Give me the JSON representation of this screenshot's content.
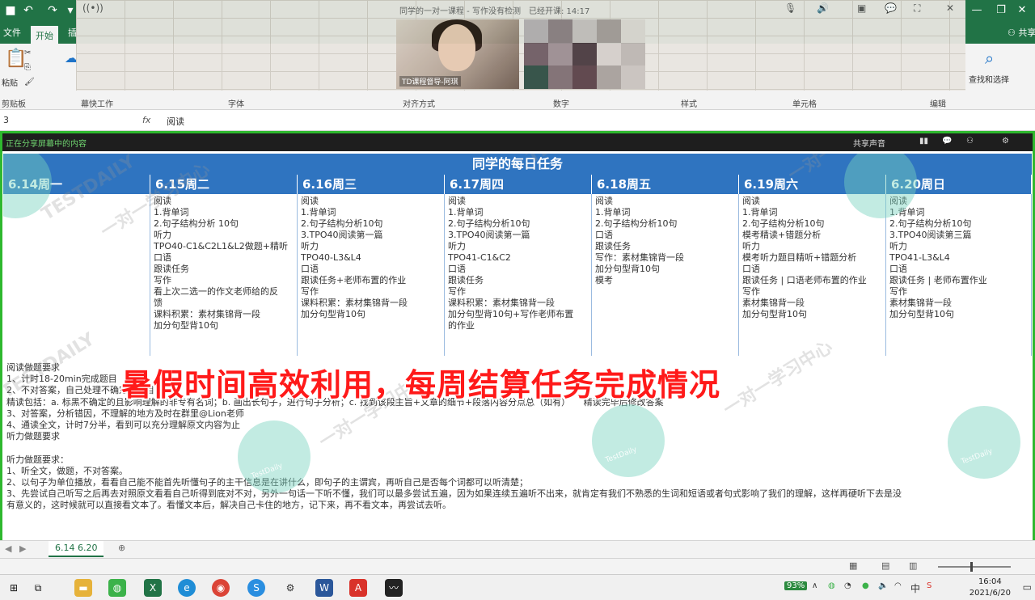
{
  "window": {
    "meeting_title": "同学的一对一课程 - 写作没有检测　已经开课: 14:17"
  },
  "ribbon": {
    "tabs": [
      "文件",
      "开始",
      "插"
    ],
    "active_tab": "开始",
    "buttons": {
      "paste": "粘贴",
      "find": "查找和选择"
    },
    "groups": [
      "剪贴板",
      "幕快工作",
      "字体",
      "对齐方式",
      "数字",
      "样式",
      "单元格",
      "编辑"
    ]
  },
  "formula_bar": {
    "name_box": "3",
    "content": "阅读"
  },
  "share": {
    "label": "正在分享屏幕中的内容",
    "right": [
      "共享声音"
    ]
  },
  "sheet": {
    "title": "同学的每日任务",
    "days": [
      {
        "head": "6.14周一",
        "lines": []
      },
      {
        "head": "6.15周二",
        "lines": [
          "阅读",
          "1.背单词",
          "2.句子结构分析 10句",
          "听力",
          "TPO40-C1&C2L1&L2做题+精听",
          "口语",
          "跟读任务",
          "写作",
          "看上次二选一的作文老师给的反",
          "馈",
          "课料积累：素材集锦背一段",
          "加分句型背10句"
        ]
      },
      {
        "head": "6.16周三",
        "lines": [
          "",
          "阅读",
          "1.背单词",
          "2.句子结构分析10句",
          "3.TPO40阅读第一篇",
          "听力",
          "TPO40-L3&L4",
          "口语",
          "跟读任务+老师布置的作业",
          "写作",
          "课料积累：素材集锦背一段",
          "加分句型背10句"
        ]
      },
      {
        "head": "6.17周四",
        "lines": [
          "阅读",
          "1.背单词",
          "2.句子结构分析10句",
          "3.TPO40阅读第一篇",
          "听力",
          "TPO41-C1&C2",
          "口语",
          "跟读任务",
          "写作",
          "课料积累：素材集锦背一段",
          "加分句型背10句+写作老师布置",
          "的作业"
        ]
      },
      {
        "head": "6.18周五",
        "lines": [
          "阅读",
          "1.背单词",
          "2.句子结构分析10句",
          "口语",
          "跟读任务",
          "写作：素材集锦背一段",
          "加分句型背10句",
          "",
          "",
          "",
          "模考"
        ]
      },
      {
        "head": "6.19周六",
        "lines": [
          "",
          "",
          "阅读",
          "1.背单词",
          "2.句子结构分析10句",
          "模考精读+错题分析",
          "听力",
          "模考听力题目精听+错题分析",
          "口语",
          "跟读任务 | 口语老师布置的作业",
          "写作",
          "素材集锦背一段",
          "加分句型背10句"
        ]
      },
      {
        "head": "6.20周日",
        "lines": [
          "",
          "",
          "阅读",
          "1.背单词",
          "2.句子结构分析10句",
          "3.TPO40阅读第三篇",
          "听力",
          "TPO41-L3&L4",
          "口语",
          "跟读任务 | 老师布置作业",
          "写作",
          "素材集锦背一段",
          "加分句型背10句"
        ]
      }
    ],
    "requirements": [
      "阅读做题要求",
      "1、计时18-20min完成题目",
      "2、不对答案，自己处理不确定的题目",
      "精读包括：a. 标黑不确定的且影响理解的非专有名词；b. 画出长句子，进行句子分析；c. 找到该段主旨+文章的细节+段落内容分点总（如有）　　精读完毕后修改答案",
      "3、对答案，分析错因，不理解的地方及时在群里@Lion老师",
      "4、通读全文，计时7分半，看到可以充分理解原文内容为止",
      "听力做题要求",
      "",
      "听力做题要求：",
      "1、听全文，做题，不对答案。",
      "2、以句子为单位播放，看看自己能不能首先听懂句子的主干信息是在讲什么，即句子的主谓宾，再听自己是否每个词都可以听清楚；",
      "3、先尝试自己听写之后再去对照原文看看自己听得到底对不对，另外一句话一下听不懂，我们可以最多尝试五遍，因为如果连续五遍听不出来，就肯定有我们不熟悉的生词和短语或者句式影响了我们的理解，这样再硬听下去是没",
      "有意义的，这时候就可以直接看文本了。看懂文本后，解决自己卡住的地方，记下来，再不看文本，再尝试去听。"
    ],
    "banner": "暑假时间高效利用，每周结算任务完成情况",
    "watermarks": [
      "TESTDAILY",
      "一对一学习中心",
      "TestDaily"
    ]
  },
  "sheet_tabs": [
    "6.14 6.20"
  ],
  "taskbar": {
    "battery": "93%",
    "ime": "中",
    "time": "16:04",
    "date": "2021/6/20"
  },
  "colors": {
    "excel_green": "#217346",
    "header_blue": "#2f74c0",
    "share_green": "#2eb82e",
    "banner_red": "#ff1a1a"
  }
}
